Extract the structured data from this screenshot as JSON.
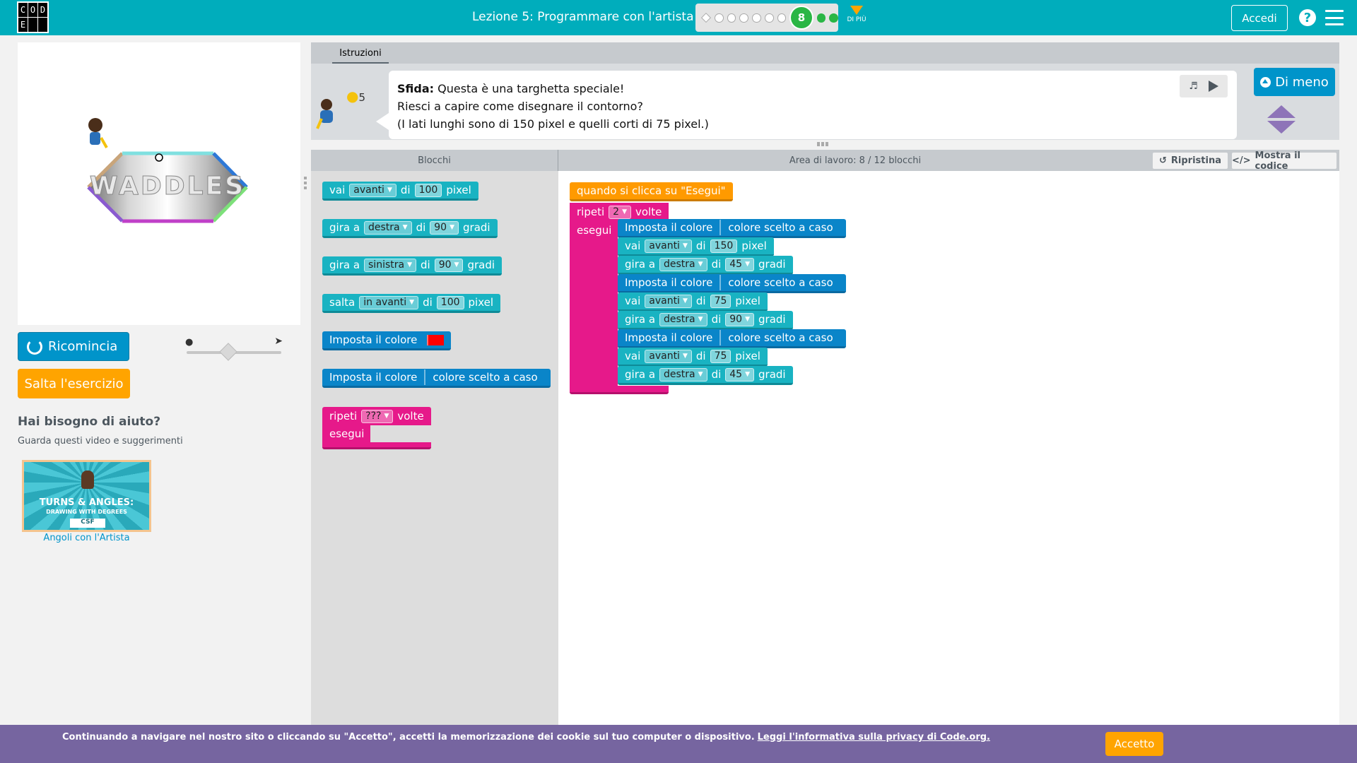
{
  "header": {
    "logo_letters": [
      "C",
      "O",
      "D",
      "E",
      "",
      ""
    ],
    "lesson_title": "Lezione 5: Programmare con l'artista",
    "current_puzzle": "8",
    "more_label": "DI PIÙ",
    "signin_label": "Accedi",
    "help_icon": "?"
  },
  "visualization": {
    "sign_text": "WADDLES"
  },
  "controls": {
    "reset_label": "Ricomincia",
    "skip_label": "Salta l'esercizio",
    "speed_slow_icon": "turtle-icon",
    "speed_fast_icon": "rabbit-icon",
    "speed_level": 0.45
  },
  "help": {
    "title": "Hai bisogno di aiuto?",
    "subtitle": "Guarda questi video e suggerimenti",
    "video_line1": "TURNS & ANGLES:",
    "video_line2": "DRAWING WITH DEGREES",
    "video_badge": "CSF",
    "video_caption": "Angoli con l'Artista"
  },
  "instructions": {
    "tab_label": "Istruzioni",
    "hint_count": "5",
    "challenge_label": "Sfida:",
    "line1": "Questa è una targhetta speciale!",
    "line2": "Riesci a capire come disegnare il contorno?",
    "line3": "(I lati lunghi sono di 150 pixel e quelli corti di 75 pixel.)",
    "less_label": "Di meno"
  },
  "workspace_header": {
    "toolbox_title": "Blocchi",
    "workspace_title": "Area di lavoro: 8 / 12 blocchi",
    "restore_label": "Ripristina",
    "show_code_label": "Mostra il codice"
  },
  "toolbox": {
    "move": {
      "verb": "vai",
      "dir": "avanti",
      "of": "di",
      "value": "100",
      "unit": "pixel"
    },
    "turn_right": {
      "verb": "gira a",
      "dir": "destra",
      "of": "di",
      "value": "90",
      "unit": "gradi"
    },
    "turn_left": {
      "verb": "gira a",
      "dir": "sinistra",
      "of": "di",
      "value": "90",
      "unit": "gradi"
    },
    "jump": {
      "verb": "salta",
      "dir": "in avanti",
      "of": "di",
      "value": "100",
      "unit": "pixel"
    },
    "set_color": {
      "label": "Imposta il colore",
      "color": "#ff0000"
    },
    "set_random_color": {
      "label": "Imposta il colore",
      "value": "colore scelto a caso"
    },
    "repeat": {
      "label": "ripeti",
      "value": "???",
      "times": "volte",
      "do": "esegui"
    }
  },
  "program": {
    "when_run": "quando si clicca su \"Esegui\"",
    "repeat": {
      "label": "ripeti",
      "value": "2",
      "times": "volte",
      "do": "esegui"
    },
    "blocks": [
      {
        "type": "color",
        "label": "Imposta il colore",
        "value": "colore scelto a caso"
      },
      {
        "type": "move",
        "verb": "vai",
        "dir": "avanti",
        "of": "di",
        "value": "150",
        "unit": "pixel"
      },
      {
        "type": "turn",
        "verb": "gira a",
        "dir": "destra",
        "of": "di",
        "value": "45",
        "unit": "gradi"
      },
      {
        "type": "color",
        "label": "Imposta il colore",
        "value": "colore scelto a caso"
      },
      {
        "type": "move",
        "verb": "vai",
        "dir": "avanti",
        "of": "di",
        "value": "75",
        "unit": "pixel"
      },
      {
        "type": "turn",
        "verb": "gira a",
        "dir": "destra",
        "of": "di",
        "value": "90",
        "unit": "gradi"
      },
      {
        "type": "color",
        "label": "Imposta il colore",
        "value": "colore scelto a caso"
      },
      {
        "type": "move",
        "verb": "vai",
        "dir": "avanti",
        "of": "di",
        "value": "75",
        "unit": "pixel"
      },
      {
        "type": "turn",
        "verb": "gira a",
        "dir": "destra",
        "of": "di",
        "value": "45",
        "unit": "gradi"
      }
    ]
  },
  "cookie": {
    "text": "Continuando a navigare nel nostro sito o cliccando su \"Accetto\", accetti la memorizzazione dei cookie sul tuo computer o dispositivo.",
    "link": "Leggi l'informativa sulla privacy di Code.org.",
    "accept_label": "Accetto"
  },
  "colors": {
    "header": "#00adbc",
    "primary_button": "#0094ca",
    "orange": "#ffa400",
    "success": "#2ab645",
    "loop_pink": "#e6198a",
    "motion_teal": "#19b3c2",
    "color_blue": "#0a85c9",
    "cookie_bar": "#7665a0"
  }
}
